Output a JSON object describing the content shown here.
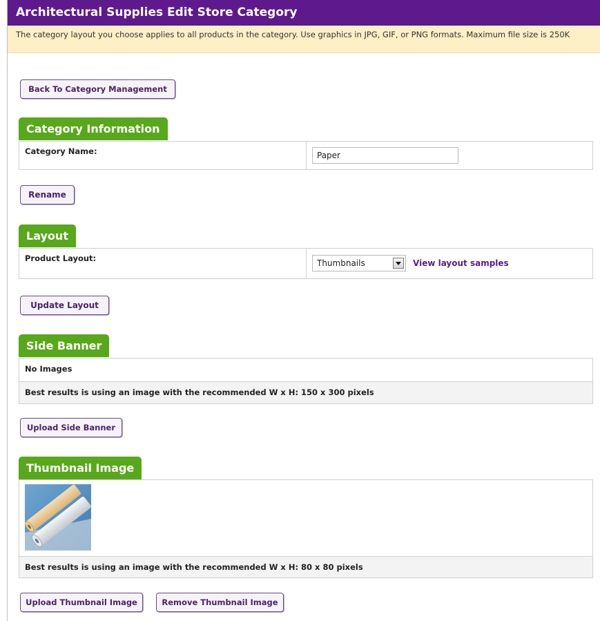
{
  "header": {
    "title": "Architectural Supplies Edit Store Category"
  },
  "notice": {
    "text": "The category layout you choose applies to all products in the category. Use graphics in JPG, GIF, or PNG formats. Maximum file size is 250K"
  },
  "buttons": {
    "back": "Back To Category Management",
    "rename": "Rename",
    "update_layout": "Update Layout",
    "upload_side_banner": "Upload Side Banner",
    "upload_thumbnail": "Upload Thumbnail Image",
    "remove_thumbnail": "Remove Thumbnail Image"
  },
  "category_info": {
    "tab": "Category Information",
    "label": "Category Name:",
    "value": "Paper"
  },
  "layout": {
    "tab": "Layout",
    "label": "Product Layout:",
    "selected": "Thumbnails",
    "samples_link": "View layout samples"
  },
  "side_banner": {
    "tab": "Side Banner",
    "status": "No Images",
    "recommendation": "Best results is using an image with the recommended W x H: 150 x 300 pixels"
  },
  "thumbnail": {
    "tab": "Thumbnail Image",
    "recommendation": "Best results is using an image with the recommended W x H: 80 x 80 pixels"
  },
  "colors": {
    "header_bg": "#5e1a8c",
    "notice_bg": "#fdefc6",
    "tab_bg": "#58a81b",
    "button_text": "#4b2367"
  }
}
